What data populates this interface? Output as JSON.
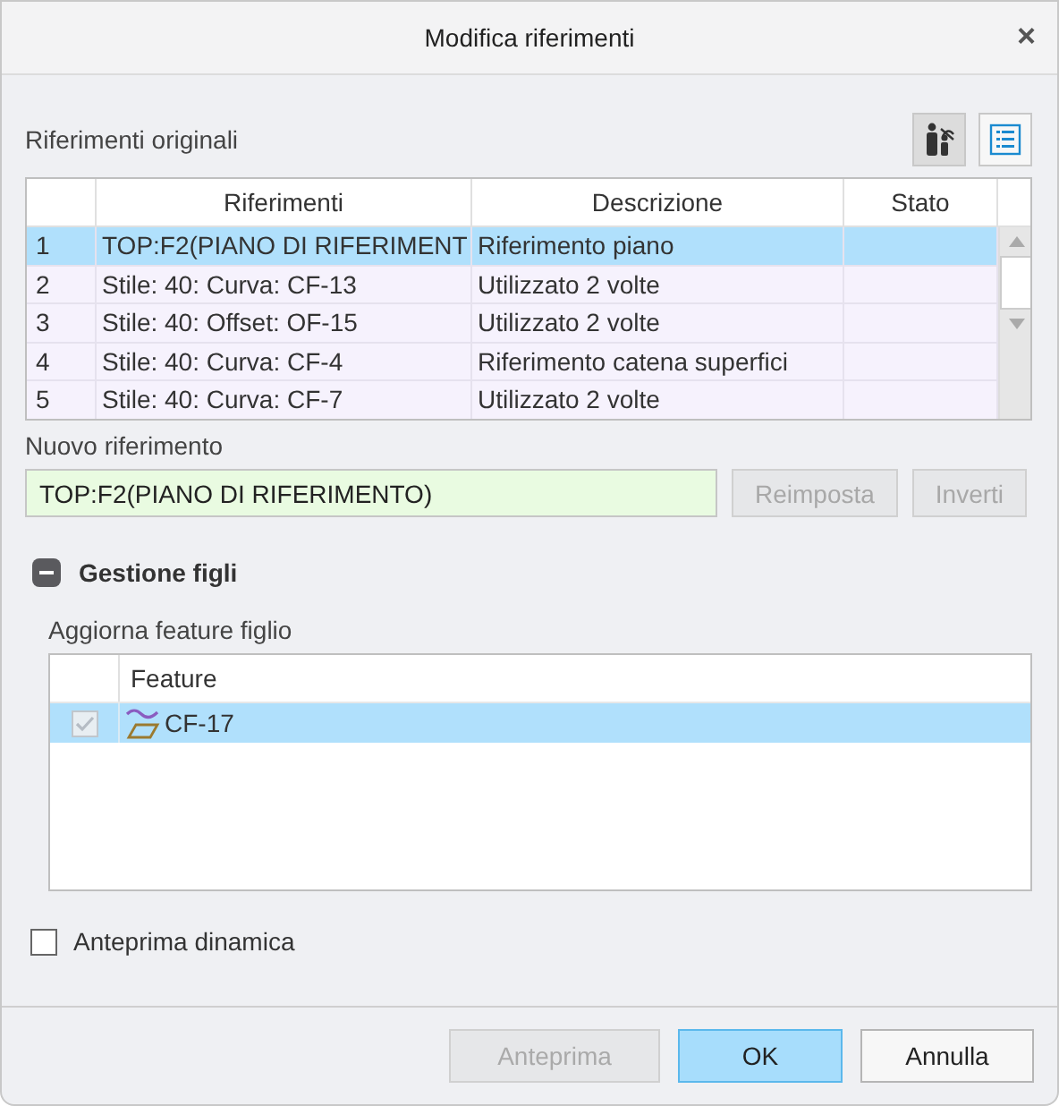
{
  "window": {
    "title": "Modifica riferimenti",
    "close": "×"
  },
  "original_refs": {
    "label": "Riferimenti originali",
    "tools": [
      {
        "kind": "filter",
        "selected": true
      },
      {
        "kind": "list",
        "selected": false
      }
    ],
    "columns": [
      "Riferimenti",
      "Descrizione",
      "Stato"
    ],
    "rows": [
      {
        "index": "1",
        "reference": "TOP:F2(PIANO DI RIFERIMENT",
        "description": "Riferimento piano",
        "selected": true
      },
      {
        "index": "2",
        "reference": "Stile: 40: Curva: CF-13",
        "description": "Utilizzato 2 volte",
        "selected": false
      },
      {
        "index": "3",
        "reference": "Stile: 40: Offset: OF-15",
        "description": "Utilizzato 2 volte",
        "selected": false
      },
      {
        "index": "4",
        "reference": "Stile: 40: Curva: CF-4",
        "description": "Riferimento catena superfici",
        "selected": false
      },
      {
        "index": "5",
        "reference": "Stile: 40: Curva: CF-7",
        "description": "Utilizzato 2 volte",
        "selected": false
      }
    ]
  },
  "new_ref": {
    "label": "Nuovo riferimento",
    "value": "TOP:F2(PIANO DI RIFERIMENTO)",
    "buttons": [
      {
        "label": "Reimposta",
        "disabled": true
      },
      {
        "label": "Inverti",
        "disabled": true
      }
    ]
  },
  "children": {
    "title": "Gestione figli",
    "expanded": true,
    "label": "Aggiorna feature figlio",
    "columns": [
      "Feature"
    ],
    "rows": [
      {
        "name": "CF-17",
        "checked": true,
        "selected": true
      }
    ]
  },
  "dynamic_preview": {
    "label": "Anteprima dinamica",
    "checked": false
  },
  "buttons": [
    {
      "label": "Anteprima",
      "disabled": true,
      "kind": "plain"
    },
    {
      "label": "OK",
      "disabled": false,
      "kind": "default"
    },
    {
      "label": "Annulla",
      "disabled": false,
      "kind": "plain"
    }
  ]
}
